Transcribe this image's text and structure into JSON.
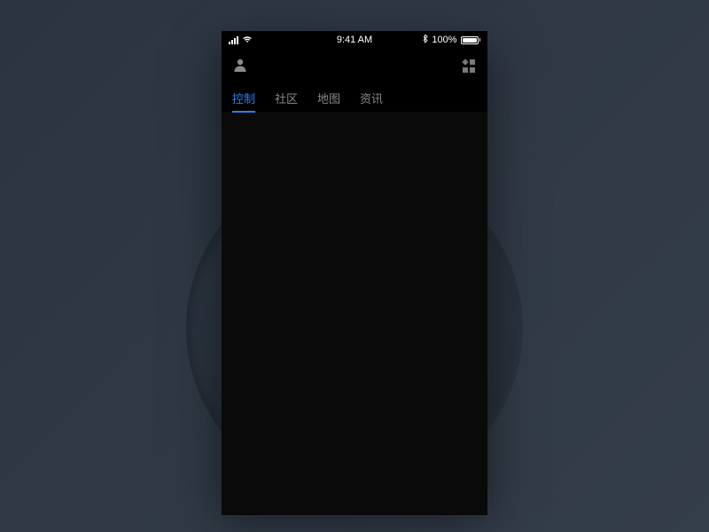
{
  "statusBar": {
    "time": "9:41 AM",
    "batteryPercent": "100%"
  },
  "tabs": {
    "items": [
      {
        "label": "控制",
        "active": true
      },
      {
        "label": "社区",
        "active": false
      },
      {
        "label": "地图",
        "active": false
      },
      {
        "label": "资讯",
        "active": false
      }
    ]
  },
  "colors": {
    "accent": "#2e7ff0",
    "background": "#000000",
    "textMuted": "#888888"
  }
}
